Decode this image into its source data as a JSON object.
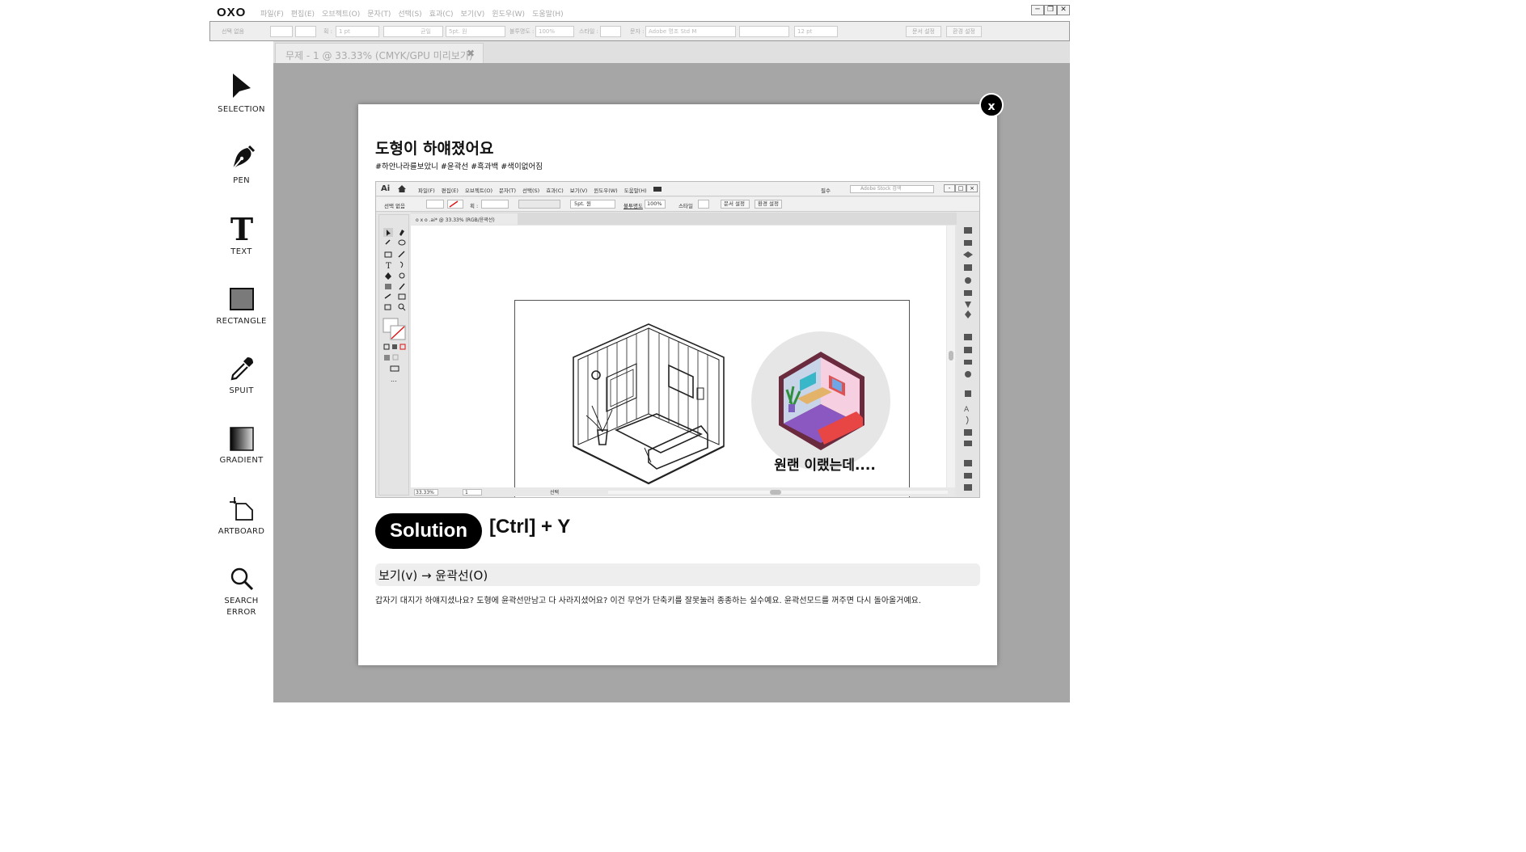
{
  "app": {
    "logo": "OXO",
    "menu": [
      "파일(F)",
      "편집(E)",
      "오브젝트(O)",
      "문자(T)",
      "선택(S)",
      "효과(C)",
      "보기(V)",
      "윈도우(W)",
      "도움말(H)"
    ],
    "window_controls": [
      "─",
      "❐",
      "✕"
    ]
  },
  "options_bar": {
    "selection_label": "선택 없음",
    "stroke_label": "획 :",
    "stroke_value": "1 pt",
    "line_style": "균일",
    "brush": "5pt. 원",
    "opacity_label": "불투명도 :",
    "opacity_value": "100%",
    "style_label": "스타일 :",
    "font_label": "문자 :",
    "font_value": "Adobe 명조 Std M",
    "font_size": "12 pt",
    "doc_setup": "문서 설정",
    "preferences": "환경 설정"
  },
  "tools": [
    {
      "label": "SELECTION",
      "icon": "selection-arrow-icon"
    },
    {
      "label": "PEN",
      "icon": "pen-nib-icon"
    },
    {
      "label": "TEXT",
      "icon": "text-t-icon"
    },
    {
      "label": "RECTANGLE",
      "icon": "rectangle-icon"
    },
    {
      "label": "SPUIT",
      "icon": "eyedropper-icon"
    },
    {
      "label": "GRADIENT",
      "icon": "gradient-swatch-icon"
    },
    {
      "label": "ARTBOARD",
      "icon": "artboard-crop-icon"
    },
    {
      "label": "SEARCH",
      "label2": "ERROR",
      "icon": "magnifier-icon"
    }
  ],
  "document_tab": {
    "title": "무제 - 1 @ 33.33% (CMYK/GPU 미리보기)",
    "close": "✖"
  },
  "modal": {
    "close": "x",
    "title": "도형이 하얘졌어요",
    "tags": "#하안나라를보았니 #윤곽선 #흑과백 #색이없어짐",
    "solution_badge": "Solution",
    "shortcut": "[Ctrl]  +  Y",
    "menu_path": "보기(v) → 윤곽선(O)",
    "description": "갑자기 대지가 하얘지셨나요? 도형에 윤곽선만남고 다 사라지셨어요? 이건 무언가 단축키를 잘못눌러 종종하는 실수예요. 윤곽선모드를 꺼주면 다시 돌아올거예요.",
    "screenshot": {
      "ai_logo": "Ai",
      "menu": [
        "파일(F)",
        "편집(E)",
        "오브젝트(O)",
        "문자(T)",
        "선택(S)",
        "효과(C)",
        "보기(V)",
        "윈도우(W)",
        "도움말(H)"
      ],
      "workspace": "필수",
      "search_placeholder": "Adobe Stock 검색",
      "selection_label": "선택 없음",
      "stroke_label": "획 :",
      "brush": "5pt. 원",
      "opacity_label": "불투명도",
      "opacity_value": "100%",
      "style_label": "스타일",
      "doc_setup": "문서 설정",
      "preferences": "환경 설정",
      "tab_title": "o x o .ai* @ 33.33% (RGB/윤곽선)",
      "zoom": "33.33%",
      "page": "1",
      "status": "선택",
      "caption": "원랜 이랬는데...."
    }
  }
}
